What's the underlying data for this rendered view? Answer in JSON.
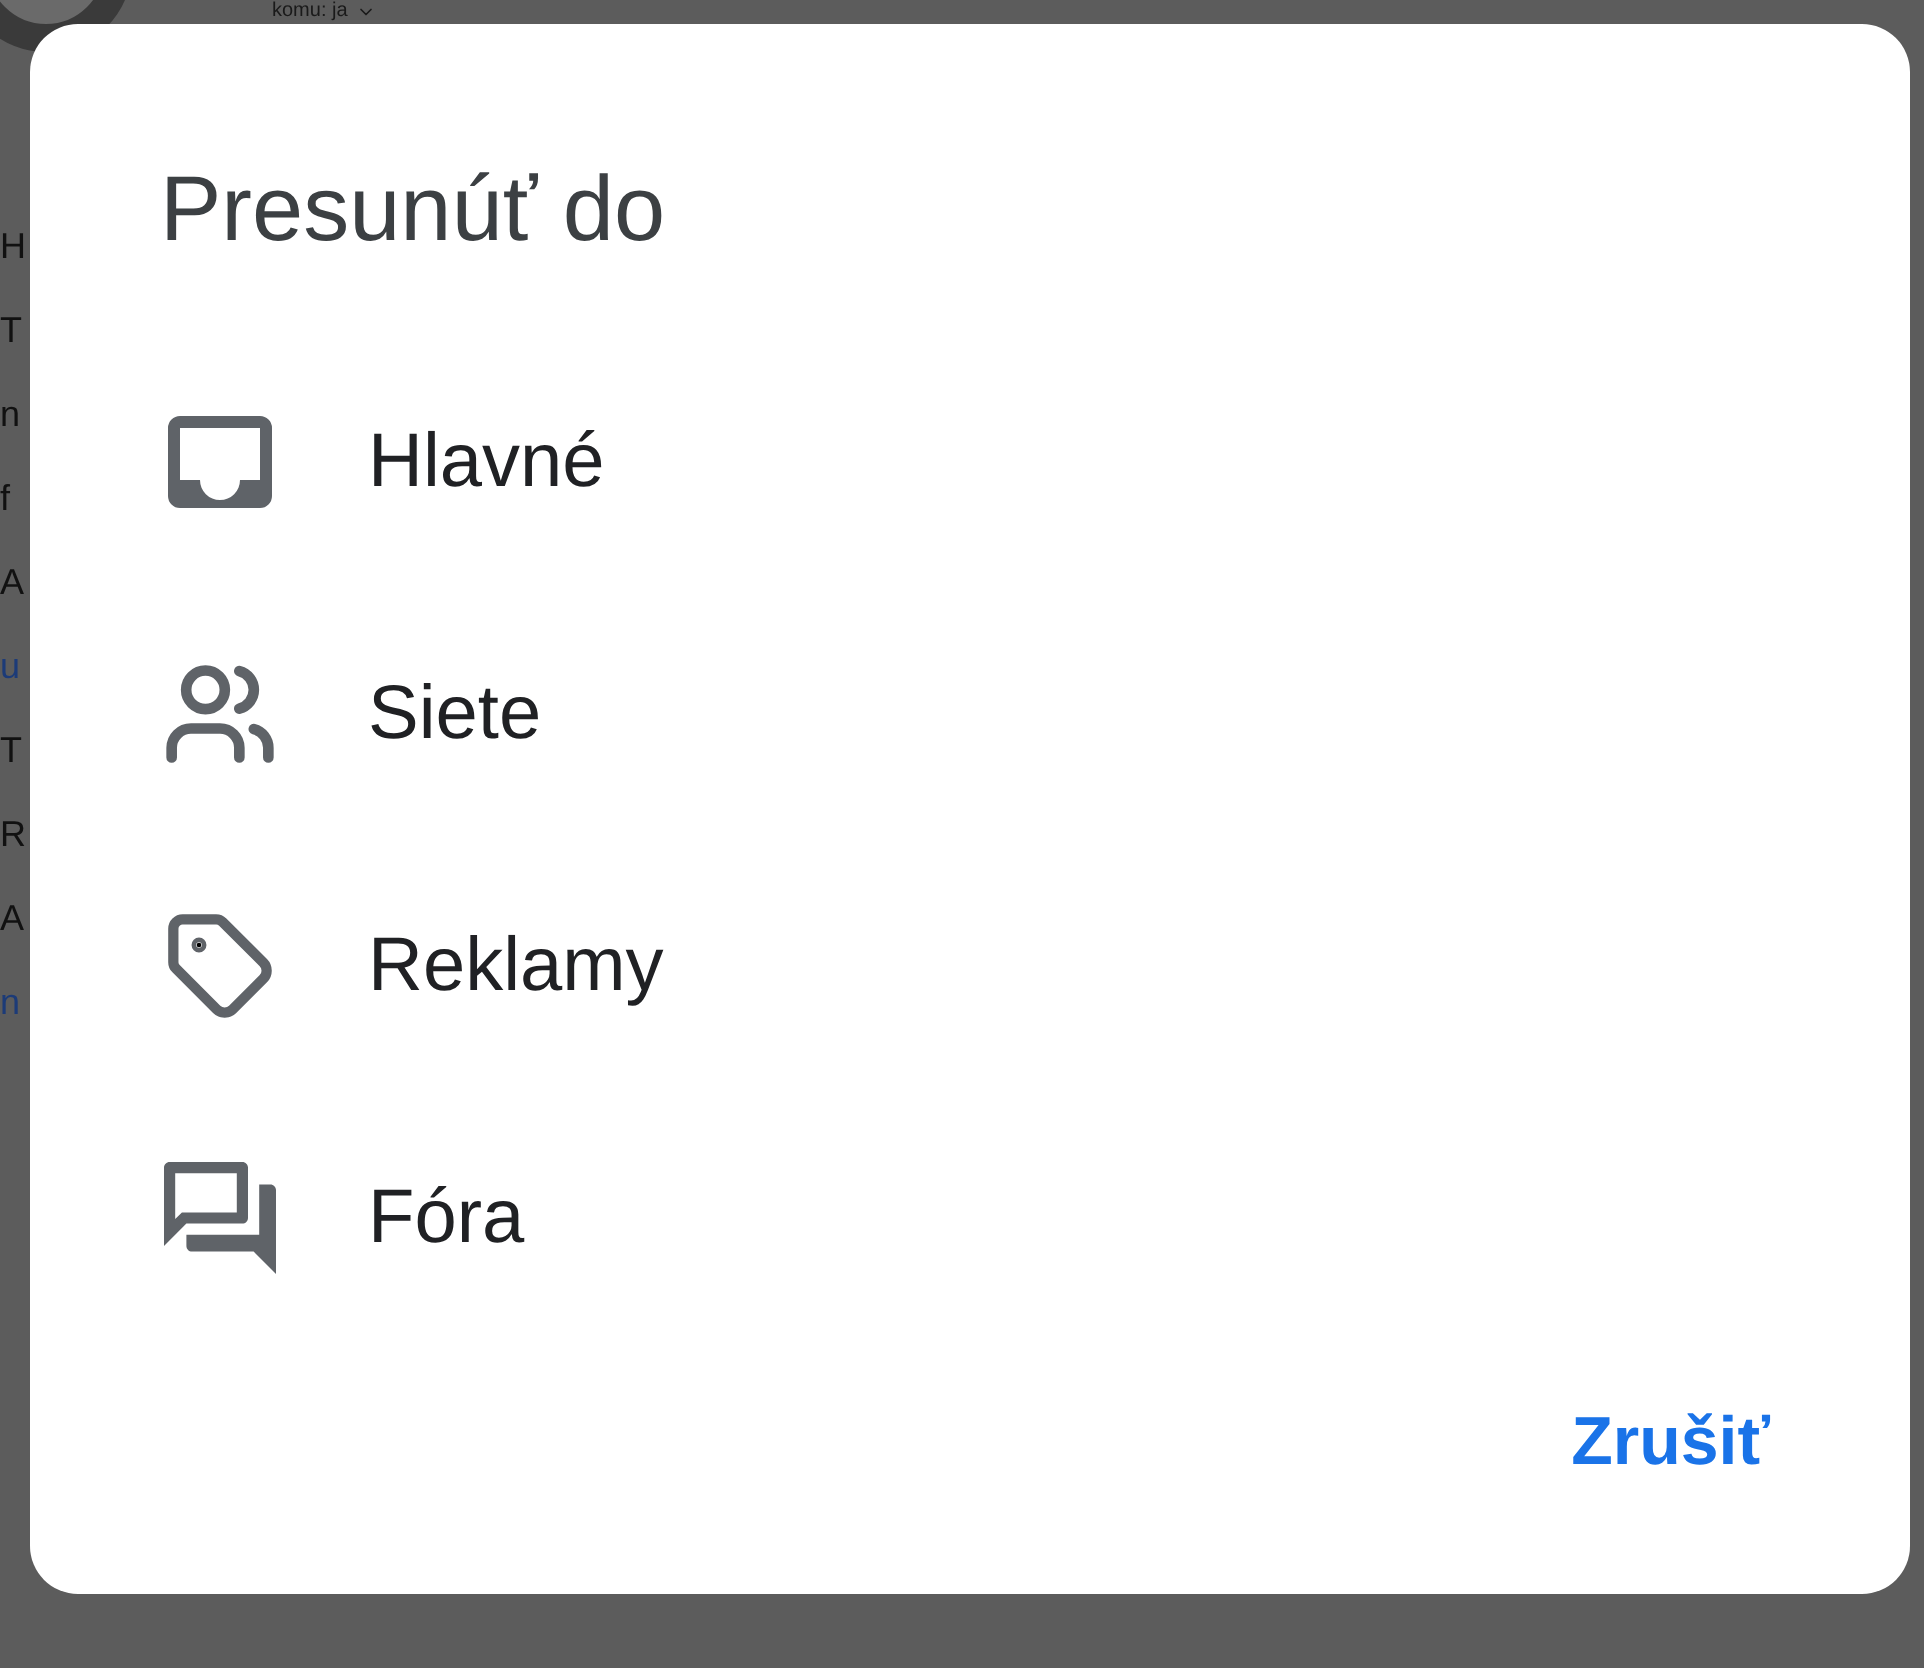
{
  "background": {
    "recipient": "komu: ja",
    "lines": [
      {
        "text": "H",
        "kind": "text"
      },
      {
        "text": "T",
        "kind": "text"
      },
      {
        "text": "n",
        "kind": "text"
      },
      {
        "text": "f",
        "kind": "text"
      },
      {
        "text": "A",
        "kind": "text"
      },
      {
        "text": "u",
        "kind": "link"
      },
      {
        "text": "T",
        "kind": "text"
      },
      {
        "text": "R",
        "kind": "text"
      },
      {
        "text": "A",
        "kind": "text"
      },
      {
        "text": "n",
        "kind": "link"
      }
    ]
  },
  "dialog": {
    "title": "Presunúť do",
    "items": [
      {
        "label": "Hlavné",
        "kind": "inbox"
      },
      {
        "label": "Siete",
        "kind": "people"
      },
      {
        "label": "Reklamy",
        "kind": "tag"
      },
      {
        "label": "Fóra",
        "kind": "forum"
      }
    ],
    "cancel": "Zrušiť"
  }
}
